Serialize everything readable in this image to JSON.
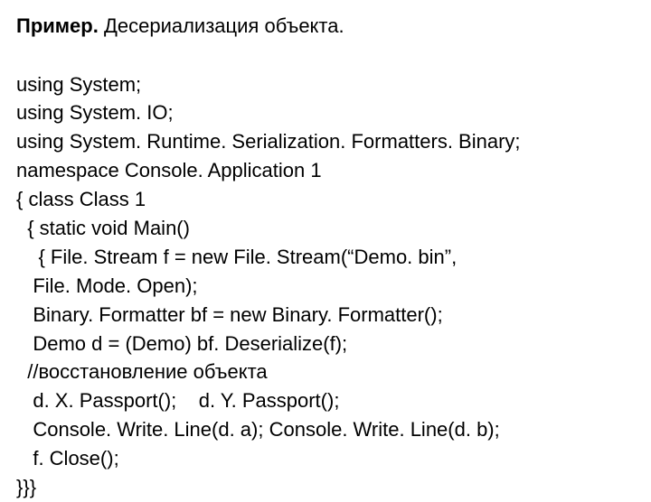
{
  "title": {
    "label": "Пример.",
    "desc": "Десериализация объекта."
  },
  "code_lines": {
    "l0": "using System;",
    "l1": "using System. IO;",
    "l2": "using System. Runtime. Serialization. Formatters. Binary;",
    "l3": "namespace Console. Application 1",
    "l4": "{ class Class 1",
    "l5": "  { static void Main()",
    "l6": "    { File. Stream f = new File. Stream(“Demo. bin”,",
    "l7": "   File. Mode. Open);",
    "l8": "   Binary. Formatter bf = new Binary. Formatter();",
    "l9": "   Demo d = (Demo) bf. Deserialize(f);",
    "l10": "  //восстановление объекта",
    "l11": "   d. X. Passport();    d. Y. Passport();",
    "l12": "   Console. Write. Line(d. a); Console. Write. Line(d. b);",
    "l13": "   f. Close();",
    "l14": "}}}"
  }
}
